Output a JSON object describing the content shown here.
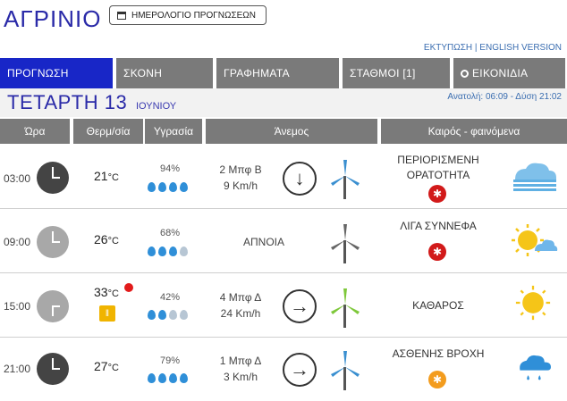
{
  "page": {
    "city": "ΑΓΡΙΝΙΟ",
    "calendar_button": "ΗΜΕΡΟΛΟΓΙΟ ΠΡΟΓΝΩΣΕΩΝ",
    "print_link": "ΕΚΤΥΠΩΣΗ",
    "separator": "|",
    "english_link": "ENGLISH VERSION"
  },
  "tabs": [
    {
      "label": "ΠΡΟΓΝΩΣΗ",
      "active": true
    },
    {
      "label": "ΣΚΟΝΗ"
    },
    {
      "label": "ΓΡΑΦΗΜΑΤΑ"
    },
    {
      "label": "ΣΤΑΘΜΟΙ [1]"
    },
    {
      "label": "ΕΙΚΟΝΙΔΙΑ",
      "icon": "gear-icon"
    }
  ],
  "day": {
    "name": "ΤΕΤΑΡΤΗ 13",
    "month": "ΙΟΥΝΙΟΥ",
    "sun_times": "Ανατολή: 06:09 - Δύση 21:02"
  },
  "columns": [
    "Ώρα",
    "Θερμ/σία",
    "Υγρασία",
    "Άνεμος",
    "Καιρός - φαινόμενα"
  ],
  "rows": [
    {
      "time": "03:00",
      "temp": "21",
      "unit": "°C",
      "humidity": "94%",
      "drops": 4,
      "wind_line1": "2 Μπφ Β",
      "wind_line2": "9 Km/h",
      "wind_arrow": "↓",
      "cond_line1": "ΠΕΡΙΟΡΙΣΜΕΝΗ",
      "cond_line2": "ΟΡΑΤΟΤΗΤΑ",
      "alert": "red",
      "icon": "fog-icon"
    },
    {
      "time": "09:00",
      "temp": "26",
      "unit": "°C",
      "humidity": "68%",
      "drops": 3,
      "wind_line1": "ΑΠΝΟΙΑ",
      "wind_line2": "",
      "wind_arrow": "",
      "cond_line1": "ΛΙΓΑ ΣΥΝΝΕΦΑ",
      "cond_line2": "",
      "alert": "red",
      "icon": "sun-cloud-icon"
    },
    {
      "time": "15:00",
      "temp": "33",
      "unit": "°C",
      "humidity": "42%",
      "drops": 2,
      "wind_line1": "4 Μπφ Δ",
      "wind_line2": "24 Km/h",
      "wind_arrow": "→",
      "cond_line1": "ΚΑΘΑΡΟΣ",
      "cond_line2": "",
      "alert": "",
      "icon": "sun-icon"
    },
    {
      "time": "21:00",
      "temp": "27",
      "unit": "°C",
      "humidity": "79%",
      "drops": 4,
      "wind_line1": "1 Μπφ Δ",
      "wind_line2": "3 Km/h",
      "wind_arrow": "→",
      "cond_line1": "ΑΣΘΕΝΗΣ ΒΡΟΧΗ",
      "cond_line2": "",
      "alert": "orange",
      "icon": "rain-cloud-icon"
    }
  ],
  "colors": {
    "brand": "#2a2aa8",
    "tab_active": "#1826c7",
    "tab": "#7a7a7a",
    "alert_red": "#d21a1a",
    "alert_orange": "#f39c1e"
  }
}
